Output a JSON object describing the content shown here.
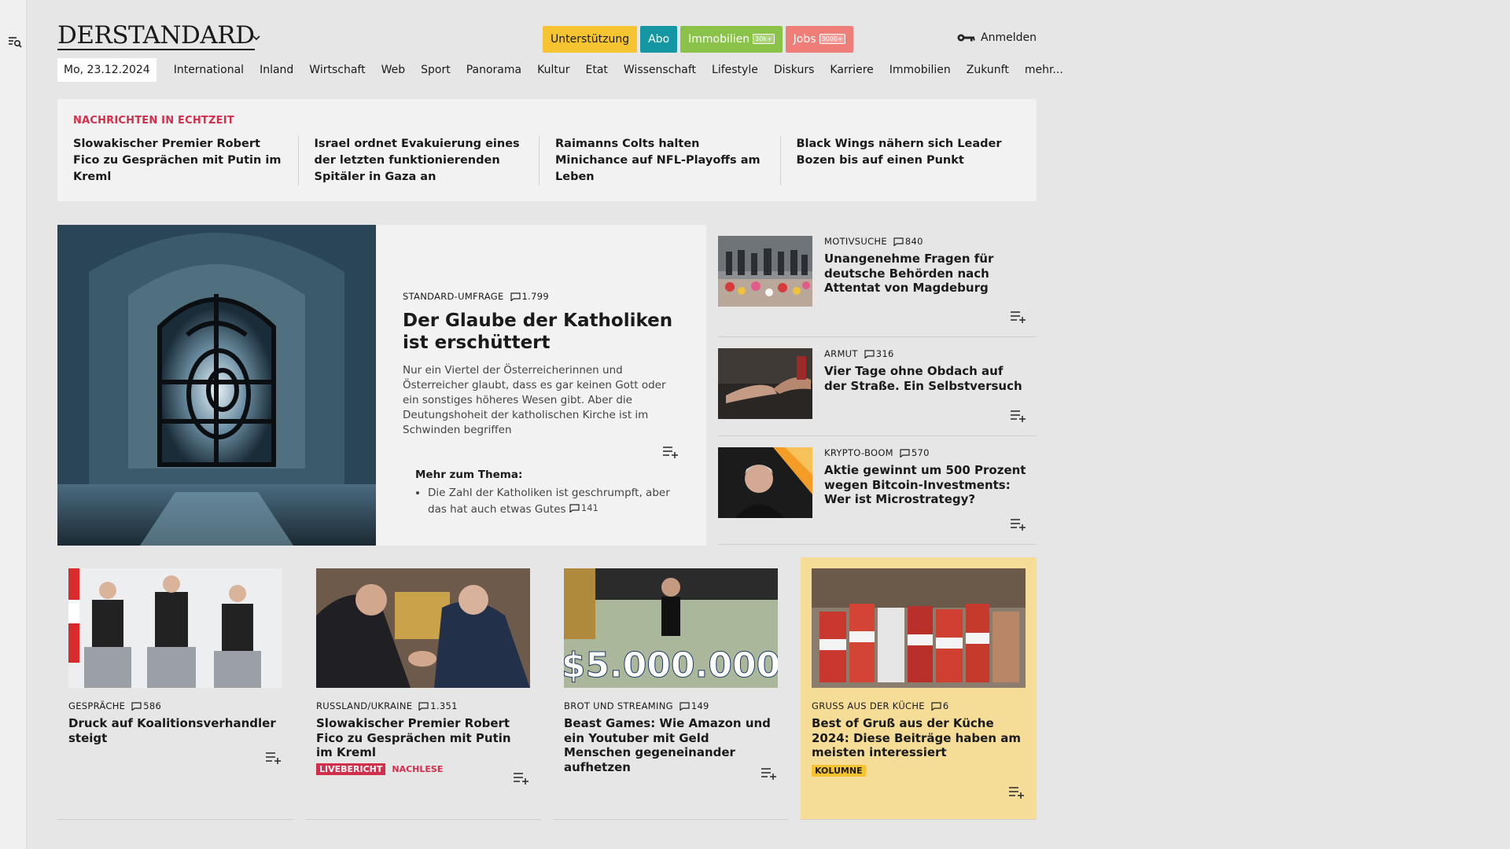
{
  "header": {
    "logo": "DERSTANDARD",
    "pills": [
      {
        "label": "Unterstützung"
      },
      {
        "label": "Abo"
      },
      {
        "label": "Immobilien",
        "tag": "30k+"
      },
      {
        "label": "Jobs",
        "tag": "3000+"
      }
    ],
    "login": "Anmelden"
  },
  "nav": {
    "date": "Mo, 23.12.2024",
    "items": [
      "International",
      "Inland",
      "Wirtschaft",
      "Web",
      "Sport",
      "Panorama",
      "Kultur",
      "Etat",
      "Wissenschaft",
      "Lifestyle",
      "Diskurs",
      "Karriere",
      "Immobilien",
      "Zukunft",
      "mehr..."
    ]
  },
  "live": {
    "label": "NACHRICHTEN IN ECHTZEIT",
    "items": [
      "Slowakischer Premier Robert Fico zu Gesprächen mit Putin im Kreml",
      "Israel ordnet Evakuierung eines der letzten funktionierenden Spitäler in Gaza an",
      "Raimanns Colts halten Minichance auf NFL-Playoffs am Leben",
      "Black Wings nähern sich Leader Bo­zen bis auf einen Punkt"
    ]
  },
  "hero": {
    "kicker": "STANDARD-UMFRAGE",
    "comments": "1.799",
    "title": "Der Glaube der Katholiken ist erschüttert",
    "teaser": "Nur ein Viertel der Österreicherinnen und Österreicher glaubt, dass es gar keinen Gott oder ein sonstiges höheres Wesen gibt. Aber die Deutungshoheit der katholischen Kirche ist im Schwinden begriffen",
    "more_title": "Mehr zum Thema:",
    "more_item": "Die Zahl der Katholiken ist geschrumpft, aber das hat auch etwas Gutes",
    "more_comments": "141"
  },
  "side": [
    {
      "kicker": "MOTIVSUCHE",
      "comments": "840",
      "title": "Unangenehme Fragen für deutsche Behörden nach Attentat von Magdeburg"
    },
    {
      "kicker": "ARMUT",
      "comments": "316",
      "title": "Vier Tage ohne Obdach auf der Straße. Ein Selbstversuch"
    },
    {
      "kicker": "KRYPTO-BOOM",
      "comments": "570",
      "title": "Aktie gewinnt um 500 Prozent wegen Bitcoin-Investments: Wer ist Microstrategy?"
    }
  ],
  "cards": [
    {
      "kicker": "GESPRÄCHE",
      "comments": "586",
      "title": "Druck auf Koalitionsverhandler steigt"
    },
    {
      "kicker": "RUSSLAND/UKRAINE",
      "comments": "1.351",
      "title": "Slowakischer Premier Robert Fico zu Gesprächen mit Putin im Kreml",
      "badge_live": "LIVEBERICHT",
      "badge_nach": "NACHLESE"
    },
    {
      "kicker": "BROT UND STREAMING",
      "comments": "149",
      "title": "Beast Games: Wie Amazon und ein Youtuber mit Geld Menschen gegeneinander aufhetzen",
      "img_text": "$5.000.000"
    },
    {
      "kicker": "GRUSS AUS DER KÜCHE",
      "comments": "6",
      "title": "Best of Gruß aus der Küche 2024: Diese Beiträge haben am meisten interessiert",
      "badge_kolumne": "KOLUMNE"
    }
  ],
  "colors": {
    "accent_red": "#d22f4c",
    "support": "#f6c331",
    "abo": "#1597a3",
    "immo": "#8bc34a",
    "jobs": "#ef7e78",
    "column_bg": "#f5dd97"
  }
}
